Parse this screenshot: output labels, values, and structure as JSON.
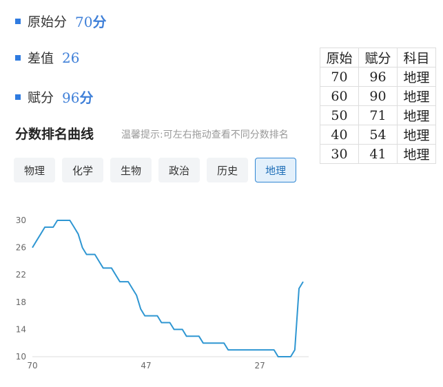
{
  "stats": [
    {
      "label": "原始分",
      "value": "70",
      "unit": "分"
    },
    {
      "label": "差值",
      "value": "26",
      "unit": ""
    },
    {
      "label": "赋分",
      "value": "96",
      "unit": "分"
    }
  ],
  "table": {
    "headers": [
      "原始",
      "赋分",
      "科目"
    ],
    "rows": [
      [
        "70",
        "96",
        "地理"
      ],
      [
        "60",
        "90",
        "地理"
      ],
      [
        "50",
        "71",
        "地理"
      ],
      [
        "40",
        "54",
        "地理"
      ],
      [
        "30",
        "41",
        "地理"
      ]
    ]
  },
  "section_title": "分数排名曲线",
  "tip": "温馨提示:可左右拖动查看不同分数排名",
  "tabs": [
    {
      "label": "物理",
      "active": false
    },
    {
      "label": "化学",
      "active": false
    },
    {
      "label": "生物",
      "active": false
    },
    {
      "label": "政治",
      "active": false
    },
    {
      "label": "历史",
      "active": false
    },
    {
      "label": "地理",
      "active": true
    }
  ],
  "colors": {
    "accent": "#2f7be0",
    "line": "#2e96d2",
    "tab_active_border": "#2f86d3"
  },
  "chart_data": {
    "type": "line",
    "title": "",
    "xlabel": "",
    "ylabel": "",
    "x_ticks": [
      "70",
      "47",
      "27"
    ],
    "y_ticks": [
      10,
      14,
      18,
      22,
      26,
      30
    ],
    "ylim": [
      10,
      30
    ],
    "grid": false,
    "series": [
      {
        "values": [
          26,
          27,
          28,
          29,
          29,
          29,
          30,
          30,
          30,
          30,
          29,
          28,
          26,
          25,
          25,
          25,
          24,
          23,
          23,
          23,
          22,
          21,
          21,
          21,
          20,
          19,
          17,
          16,
          16,
          16,
          16,
          15,
          15,
          15,
          14,
          14,
          14,
          13,
          13,
          13,
          13,
          12,
          12,
          12,
          12,
          12,
          12,
          11,
          11,
          11,
          11,
          11,
          11,
          11,
          11,
          11,
          11,
          11,
          11,
          10,
          10,
          10,
          10,
          11,
          20,
          21
        ]
      }
    ]
  }
}
